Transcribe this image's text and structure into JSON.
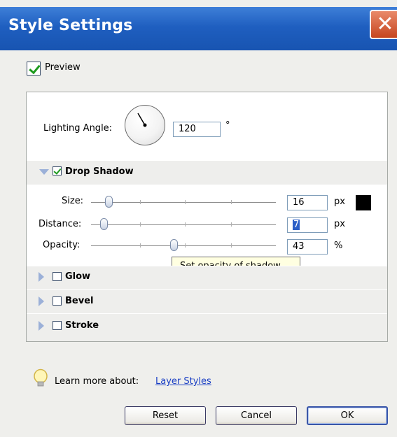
{
  "window": {
    "title": "Style Settings"
  },
  "preview": {
    "label": "Preview",
    "checked": true
  },
  "lighting": {
    "label": "Lighting Angle:",
    "value": "120",
    "unit": "°",
    "angle_degrees": 120
  },
  "drop_shadow": {
    "label": "Drop Shadow",
    "checked": true,
    "expanded": true,
    "color": "#000000",
    "size": {
      "label": "Size:",
      "value": "16",
      "unit": "px"
    },
    "distance": {
      "label": "Distance:",
      "value": "7",
      "unit": "px"
    },
    "opacity": {
      "label": "Opacity:",
      "value": "43",
      "unit": "%"
    },
    "tooltip": "Set opacity of shadow"
  },
  "sections": [
    {
      "label": "Glow",
      "checked": false,
      "expanded": false
    },
    {
      "label": "Bevel",
      "checked": false,
      "expanded": false
    },
    {
      "label": "Stroke",
      "checked": false,
      "expanded": false
    }
  ],
  "learn_more": {
    "label": "Learn more about:",
    "link": "Layer Styles"
  },
  "buttons": {
    "reset": "Reset",
    "cancel": "Cancel",
    "ok": "OK"
  },
  "colors": {
    "titlebar": "#1f5fc0",
    "close": "#c6451f",
    "link": "#1a3fc4",
    "check": "#1d9a1d"
  },
  "icons": {
    "close": "close-icon",
    "expand": "triangle-icon",
    "tip": "lightbulb-icon"
  }
}
